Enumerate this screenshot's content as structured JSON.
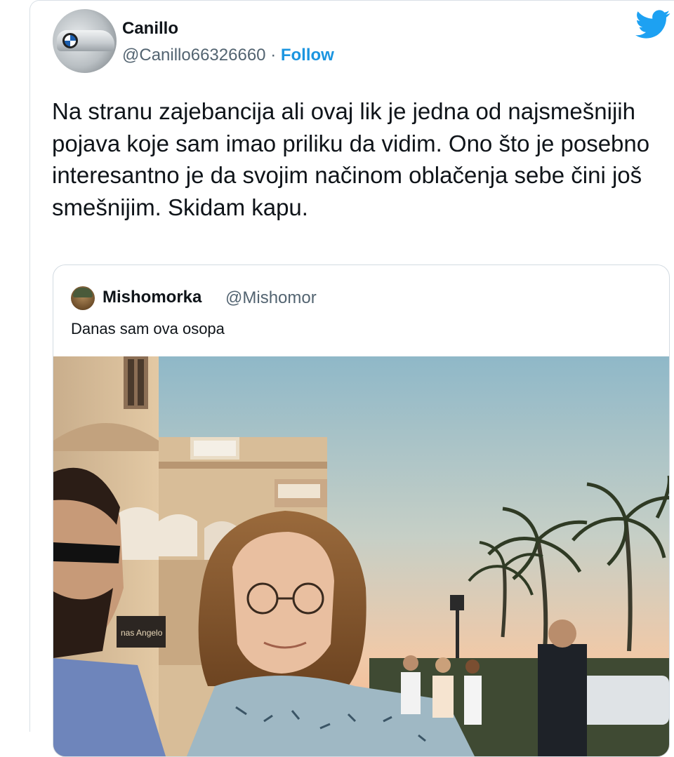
{
  "tweet": {
    "author_name": "Canillo",
    "author_handle": "@Canillo66326660",
    "separator": "·",
    "follow_label": "Follow",
    "text": "Na stranu zajebancija ali ovaj lik je jedna od najsmešnijih pojava koje sam imao priliku da vidim. Ono što je posebno interesantno je da svojim načinom oblačenja sebe čini još smešnijim. Skidam kapu."
  },
  "quoted_tweet": {
    "author_name": "Mishomorka",
    "author_handle": "@Mishomor",
    "text": "Danas sam ova osopa",
    "photo_sign_text": "nas Angelo"
  },
  "icons": {
    "brand": "twitter-bird-icon"
  },
  "colors": {
    "follow": "#1b95e0",
    "twitter_blue": "#1da1f2",
    "text": "#0f1419",
    "secondary_text": "#536471"
  }
}
